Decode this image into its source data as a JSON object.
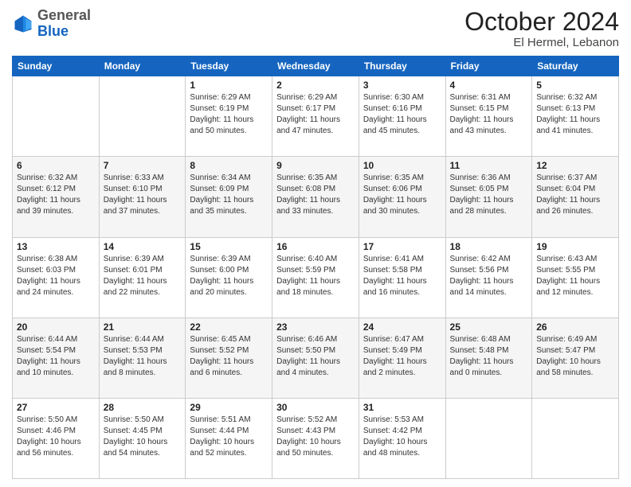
{
  "header": {
    "logo": {
      "line1": "General",
      "line2": "Blue"
    },
    "month": "October 2024",
    "location": "El Hermel, Lebanon"
  },
  "weekdays": [
    "Sunday",
    "Monday",
    "Tuesday",
    "Wednesday",
    "Thursday",
    "Friday",
    "Saturday"
  ],
  "weeks": [
    [
      {
        "day": "",
        "sunrise": "",
        "sunset": "",
        "daylight": ""
      },
      {
        "day": "",
        "sunrise": "",
        "sunset": "",
        "daylight": ""
      },
      {
        "day": "1",
        "sunrise": "Sunrise: 6:29 AM",
        "sunset": "Sunset: 6:19 PM",
        "daylight": "Daylight: 11 hours and 50 minutes."
      },
      {
        "day": "2",
        "sunrise": "Sunrise: 6:29 AM",
        "sunset": "Sunset: 6:17 PM",
        "daylight": "Daylight: 11 hours and 47 minutes."
      },
      {
        "day": "3",
        "sunrise": "Sunrise: 6:30 AM",
        "sunset": "Sunset: 6:16 PM",
        "daylight": "Daylight: 11 hours and 45 minutes."
      },
      {
        "day": "4",
        "sunrise": "Sunrise: 6:31 AM",
        "sunset": "Sunset: 6:15 PM",
        "daylight": "Daylight: 11 hours and 43 minutes."
      },
      {
        "day": "5",
        "sunrise": "Sunrise: 6:32 AM",
        "sunset": "Sunset: 6:13 PM",
        "daylight": "Daylight: 11 hours and 41 minutes."
      }
    ],
    [
      {
        "day": "6",
        "sunrise": "Sunrise: 6:32 AM",
        "sunset": "Sunset: 6:12 PM",
        "daylight": "Daylight: 11 hours and 39 minutes."
      },
      {
        "day": "7",
        "sunrise": "Sunrise: 6:33 AM",
        "sunset": "Sunset: 6:10 PM",
        "daylight": "Daylight: 11 hours and 37 minutes."
      },
      {
        "day": "8",
        "sunrise": "Sunrise: 6:34 AM",
        "sunset": "Sunset: 6:09 PM",
        "daylight": "Daylight: 11 hours and 35 minutes."
      },
      {
        "day": "9",
        "sunrise": "Sunrise: 6:35 AM",
        "sunset": "Sunset: 6:08 PM",
        "daylight": "Daylight: 11 hours and 33 minutes."
      },
      {
        "day": "10",
        "sunrise": "Sunrise: 6:35 AM",
        "sunset": "Sunset: 6:06 PM",
        "daylight": "Daylight: 11 hours and 30 minutes."
      },
      {
        "day": "11",
        "sunrise": "Sunrise: 6:36 AM",
        "sunset": "Sunset: 6:05 PM",
        "daylight": "Daylight: 11 hours and 28 minutes."
      },
      {
        "day": "12",
        "sunrise": "Sunrise: 6:37 AM",
        "sunset": "Sunset: 6:04 PM",
        "daylight": "Daylight: 11 hours and 26 minutes."
      }
    ],
    [
      {
        "day": "13",
        "sunrise": "Sunrise: 6:38 AM",
        "sunset": "Sunset: 6:03 PM",
        "daylight": "Daylight: 11 hours and 24 minutes."
      },
      {
        "day": "14",
        "sunrise": "Sunrise: 6:39 AM",
        "sunset": "Sunset: 6:01 PM",
        "daylight": "Daylight: 11 hours and 22 minutes."
      },
      {
        "day": "15",
        "sunrise": "Sunrise: 6:39 AM",
        "sunset": "Sunset: 6:00 PM",
        "daylight": "Daylight: 11 hours and 20 minutes."
      },
      {
        "day": "16",
        "sunrise": "Sunrise: 6:40 AM",
        "sunset": "Sunset: 5:59 PM",
        "daylight": "Daylight: 11 hours and 18 minutes."
      },
      {
        "day": "17",
        "sunrise": "Sunrise: 6:41 AM",
        "sunset": "Sunset: 5:58 PM",
        "daylight": "Daylight: 11 hours and 16 minutes."
      },
      {
        "day": "18",
        "sunrise": "Sunrise: 6:42 AM",
        "sunset": "Sunset: 5:56 PM",
        "daylight": "Daylight: 11 hours and 14 minutes."
      },
      {
        "day": "19",
        "sunrise": "Sunrise: 6:43 AM",
        "sunset": "Sunset: 5:55 PM",
        "daylight": "Daylight: 11 hours and 12 minutes."
      }
    ],
    [
      {
        "day": "20",
        "sunrise": "Sunrise: 6:44 AM",
        "sunset": "Sunset: 5:54 PM",
        "daylight": "Daylight: 11 hours and 10 minutes."
      },
      {
        "day": "21",
        "sunrise": "Sunrise: 6:44 AM",
        "sunset": "Sunset: 5:53 PM",
        "daylight": "Daylight: 11 hours and 8 minutes."
      },
      {
        "day": "22",
        "sunrise": "Sunrise: 6:45 AM",
        "sunset": "Sunset: 5:52 PM",
        "daylight": "Daylight: 11 hours and 6 minutes."
      },
      {
        "day": "23",
        "sunrise": "Sunrise: 6:46 AM",
        "sunset": "Sunset: 5:50 PM",
        "daylight": "Daylight: 11 hours and 4 minutes."
      },
      {
        "day": "24",
        "sunrise": "Sunrise: 6:47 AM",
        "sunset": "Sunset: 5:49 PM",
        "daylight": "Daylight: 11 hours and 2 minutes."
      },
      {
        "day": "25",
        "sunrise": "Sunrise: 6:48 AM",
        "sunset": "Sunset: 5:48 PM",
        "daylight": "Daylight: 11 hours and 0 minutes."
      },
      {
        "day": "26",
        "sunrise": "Sunrise: 6:49 AM",
        "sunset": "Sunset: 5:47 PM",
        "daylight": "Daylight: 10 hours and 58 minutes."
      }
    ],
    [
      {
        "day": "27",
        "sunrise": "Sunrise: 5:50 AM",
        "sunset": "Sunset: 4:46 PM",
        "daylight": "Daylight: 10 hours and 56 minutes."
      },
      {
        "day": "28",
        "sunrise": "Sunrise: 5:50 AM",
        "sunset": "Sunset: 4:45 PM",
        "daylight": "Daylight: 10 hours and 54 minutes."
      },
      {
        "day": "29",
        "sunrise": "Sunrise: 5:51 AM",
        "sunset": "Sunset: 4:44 PM",
        "daylight": "Daylight: 10 hours and 52 minutes."
      },
      {
        "day": "30",
        "sunrise": "Sunrise: 5:52 AM",
        "sunset": "Sunset: 4:43 PM",
        "daylight": "Daylight: 10 hours and 50 minutes."
      },
      {
        "day": "31",
        "sunrise": "Sunrise: 5:53 AM",
        "sunset": "Sunset: 4:42 PM",
        "daylight": "Daylight: 10 hours and 48 minutes."
      },
      {
        "day": "",
        "sunrise": "",
        "sunset": "",
        "daylight": ""
      },
      {
        "day": "",
        "sunrise": "",
        "sunset": "",
        "daylight": ""
      }
    ]
  ]
}
